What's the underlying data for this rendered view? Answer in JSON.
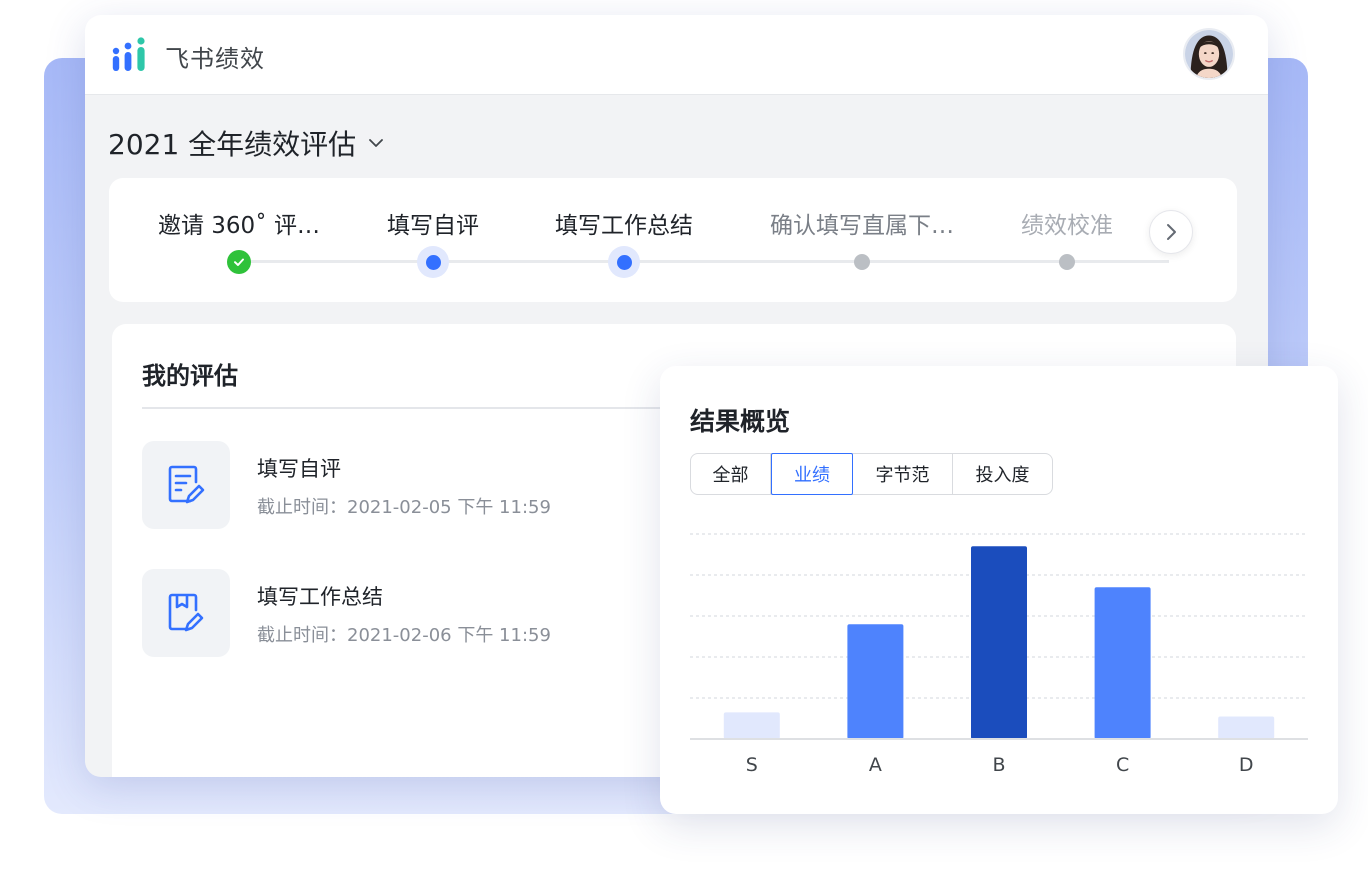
{
  "app": {
    "title": "飞书绩效"
  },
  "period": {
    "label": "2021 全年绩效评估"
  },
  "steps": [
    {
      "label": "邀请 360˚ 评…",
      "state": "done"
    },
    {
      "label": "填写自评",
      "state": "current"
    },
    {
      "label": "填写工作总结",
      "state": "current"
    },
    {
      "label": "确认填写直属下…",
      "state": "pending"
    },
    {
      "label": "绩效校准",
      "state": "pending"
    }
  ],
  "evaluation": {
    "title": "我的评估",
    "tasks": [
      {
        "name": "填写自评",
        "deadline": "截止时间：2021-02-05 下午 11:59",
        "icon": "edit-document-icon"
      },
      {
        "name": "填写工作总结",
        "deadline": "截止时间：2021-02-06 下午 11:59",
        "icon": "edit-save-icon"
      }
    ]
  },
  "results": {
    "title": "结果概览",
    "tabs": [
      "全部",
      "业绩",
      "字节范",
      "投入度"
    ],
    "selected_tab": "业绩"
  },
  "colors": {
    "accent": "#3370ff",
    "done": "#2fc23a",
    "bar_light": "#e1e8fd",
    "bar_mid": "#4e83fd",
    "bar_dark": "#1b4dbd"
  },
  "chart_data": {
    "type": "bar",
    "categories": [
      "S",
      "A",
      "B",
      "C",
      "D"
    ],
    "values": [
      13,
      56,
      94,
      74,
      11
    ],
    "highlight_index": 2,
    "ylim": [
      0,
      100
    ],
    "grid": true,
    "xlabel": "",
    "ylabel": ""
  }
}
